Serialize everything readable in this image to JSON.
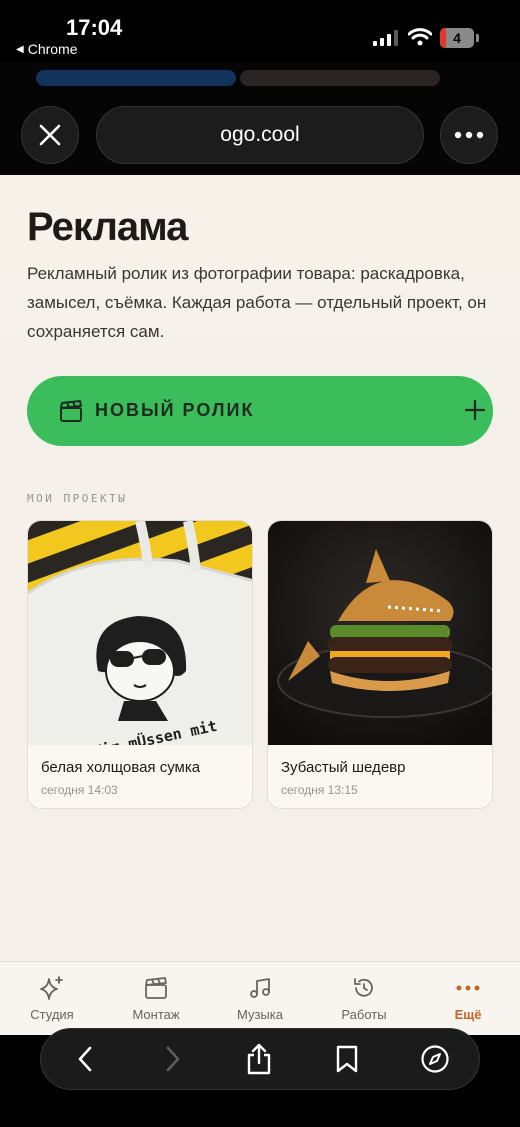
{
  "status_bar": {
    "time": "17:04",
    "back_app": "Chrome",
    "battery": "4"
  },
  "browser": {
    "url": "ogo.cool"
  },
  "page": {
    "title": "Реклама",
    "description": "Рекламный ролик из фотографии товара: раскадровка, замысел, съёмка. Каждая работа — отдельный проект, он сохраняется сам.",
    "new_button_label": "НОВЫЙ РОЛИК",
    "section_label": "МОИ ПРОЕКТЫ",
    "projects": [
      {
        "name": "белая холщовая сумка",
        "date": "сегодня 14:03",
        "image_text": "Wir mÜssen mit"
      },
      {
        "name": "Зубастый шедевр",
        "date": "сегодня 13:15"
      }
    ]
  },
  "tabbar": {
    "items": [
      {
        "label": "Студия",
        "icon": "sparkle-icon"
      },
      {
        "label": "Монтаж",
        "icon": "clapperboard-icon"
      },
      {
        "label": "Музыка",
        "icon": "music-note-icon"
      },
      {
        "label": "Работы",
        "icon": "history-icon"
      },
      {
        "label": "Ещё",
        "icon": "more-dots-icon"
      }
    ],
    "active_index": 4,
    "accent_color": "#c4661f"
  },
  "colors": {
    "cta_green": "#3bbd5c",
    "page_bg": "#f6f0ea"
  }
}
